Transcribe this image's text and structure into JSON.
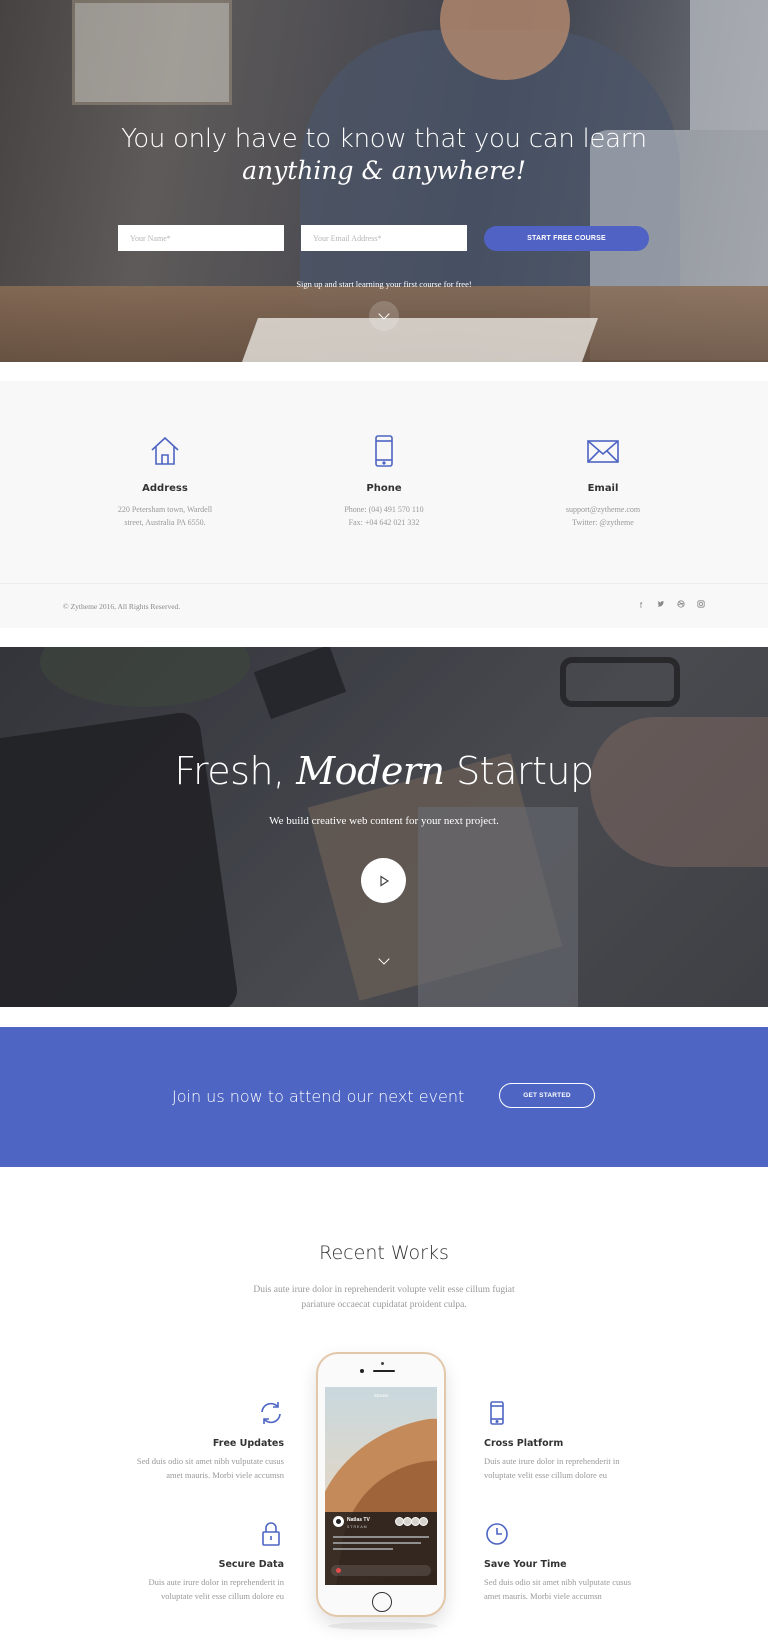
{
  "colors": {
    "accent": "#5063c4",
    "event_bg": "#4e65c3",
    "muted_text": "#999999",
    "contact_bg": "#f8f8f8"
  },
  "hero": {
    "title_line1": "You only have to know that you can learn",
    "title_line2": "anything & anywhere!",
    "name_placeholder": "Your Name*",
    "email_placeholder": "Your Email Address*",
    "button_label": "START FREE COURSE",
    "subtitle": "Sign up and start learning your first course for free!",
    "scroll_icon": "chevron-down-icon"
  },
  "contact": {
    "items": [
      {
        "icon": "home-icon",
        "label": "Address",
        "lines": [
          "220 Petersham town, Wardell",
          "street, Australia PA 6550."
        ]
      },
      {
        "icon": "mobile-phone-icon",
        "label": "Phone",
        "lines": [
          "Phone: (04) 491 570 110",
          "Fax: +04 642 021 332"
        ]
      },
      {
        "icon": "envelope-icon",
        "label": "Email",
        "lines": [
          "support@zytheme.com",
          "Twitter: @zytheme"
        ]
      }
    ],
    "copyright": "© Zytheme 2016, All Rights Reserved.",
    "socials": [
      "facebook-icon",
      "twitter-icon",
      "dribbble-icon",
      "instagram-icon"
    ]
  },
  "startup": {
    "title_part1": "Fresh,",
    "title_italic": "Modern",
    "title_part2": "Startup",
    "subtitle": "We build creative web content for your next project.",
    "play_icon": "play-icon"
  },
  "event": {
    "text": "Join us now to attend our next event",
    "button_label": "GET STARTED"
  },
  "works": {
    "title": "Recent Works",
    "subtitle_line1": "Duis aute irure dolor in reprehenderit volupte velit esse cillum fugiat",
    "subtitle_line2": "pariature occaecat cupidatat proident culpa.",
    "features": [
      {
        "icon": "refresh-icon",
        "title": "Free Updates",
        "desc_line1": "Sed duis odio sit amet nibh vulputate cusus",
        "desc_line2": "amet mauris. Morbi viele accumsn"
      },
      {
        "icon": "lock-icon",
        "title": "Secure Data",
        "desc_line1": "Duis aute irure dolor in reprehenderit in",
        "desc_line2": "voluptate velit esse cillum dolore eu"
      },
      {
        "icon": "mobile-icon",
        "title": "Cross Platform",
        "desc_line1": "Duis aute irure dolor in reprehenderit in",
        "desc_line2": "voluptate velit esse cillum dolore eu"
      },
      {
        "icon": "clock-icon",
        "title": "Save Your Time",
        "desc_line1": "Sed duis odio sit amet nibh vulputate cusus",
        "desc_line2": "amet mauris. Morbi viele accumsn"
      }
    ],
    "phone_screen": {
      "header": "Stream",
      "channel": "Natlas TV",
      "stream_label": "STREAM"
    }
  }
}
